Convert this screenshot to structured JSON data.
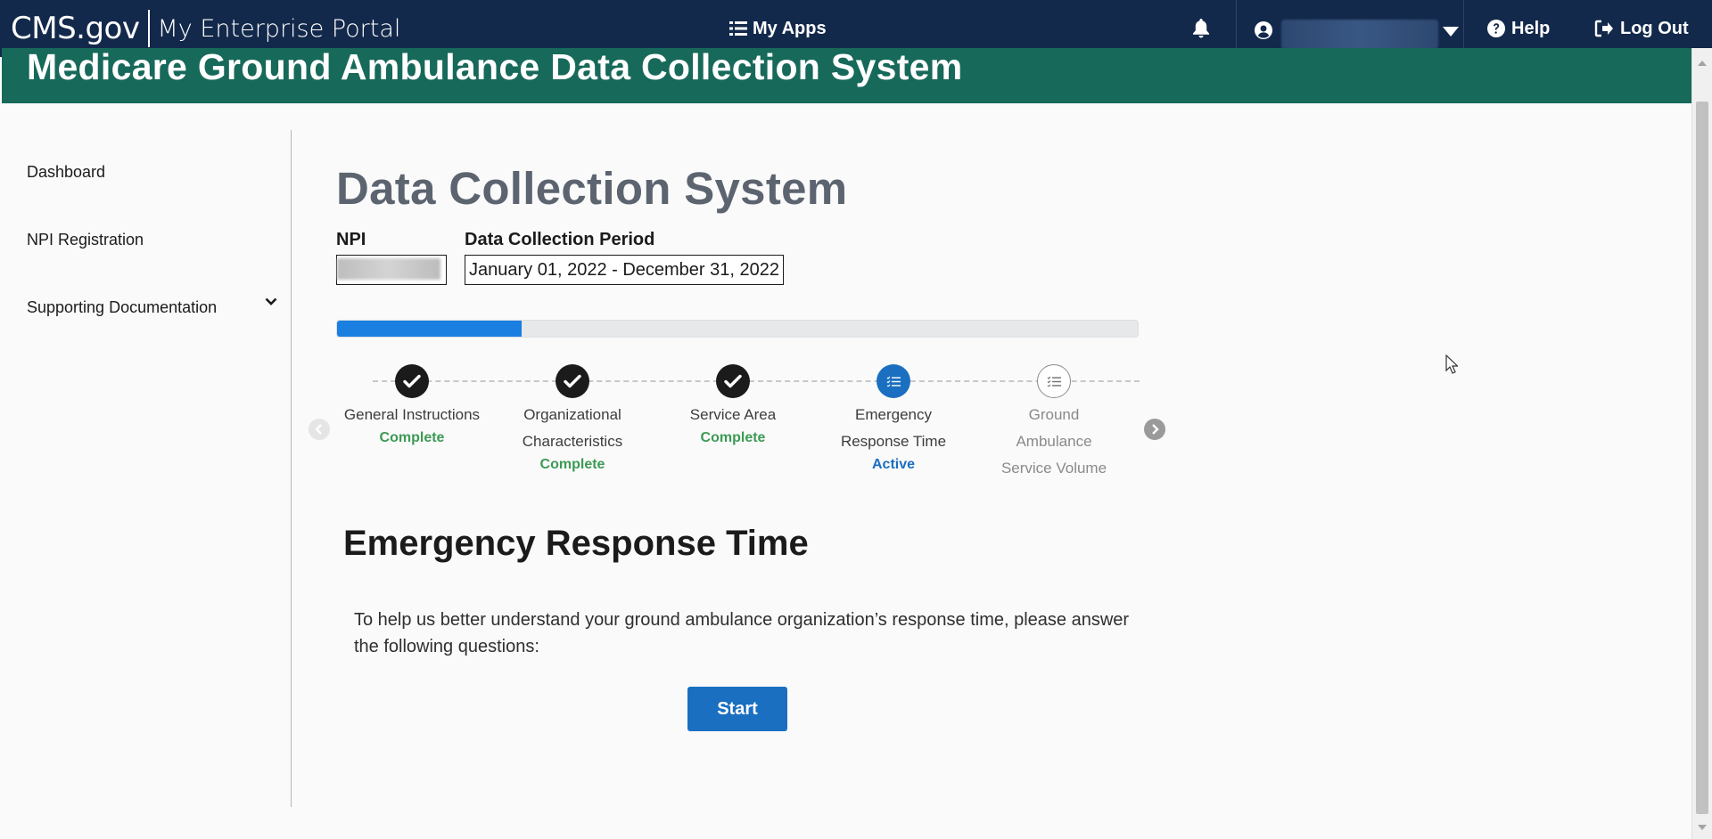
{
  "topbar": {
    "brand_cms": "CMS.gov",
    "brand_portal": "My Enterprise Portal",
    "my_apps": "My Apps",
    "help": "Help",
    "logout": "Log Out",
    "bg_color": "#13294b"
  },
  "banner": {
    "title": "Medicare Ground Ambulance Data Collection System",
    "bg_color": "#17695a"
  },
  "sidebar": {
    "items": [
      {
        "label": "Dashboard"
      },
      {
        "label": "NPI Registration"
      },
      {
        "label": "Supporting Documentation",
        "expandable": true
      }
    ]
  },
  "main": {
    "page_title": "Data Collection System",
    "npi_label": "NPI",
    "period_label": "Data Collection Period",
    "period_value": "January 01, 2022 - December 31, 2022",
    "progress_fraction": 0.23,
    "steps": [
      {
        "title": "General Instructions",
        "status": "Complete",
        "state": "complete"
      },
      {
        "title": "Organizational Characteristics",
        "status": "Complete",
        "state": "complete"
      },
      {
        "title": "Service Area",
        "status": "Complete",
        "state": "complete"
      },
      {
        "title": "Emergency Response Time",
        "status": "Active",
        "state": "active"
      },
      {
        "title": "Ground Ambulance Service Volume",
        "status": "",
        "state": "todo"
      }
    ],
    "section_title": "Emergency Response Time",
    "section_desc": "To help us better understand your ground ambulance organization’s response time, please answer the following questions:",
    "start_label": "Start"
  },
  "colors": {
    "accent_blue": "#1a6fc1",
    "complete_green": "#3d9a55",
    "progress_fill": "#1a7fe0"
  }
}
